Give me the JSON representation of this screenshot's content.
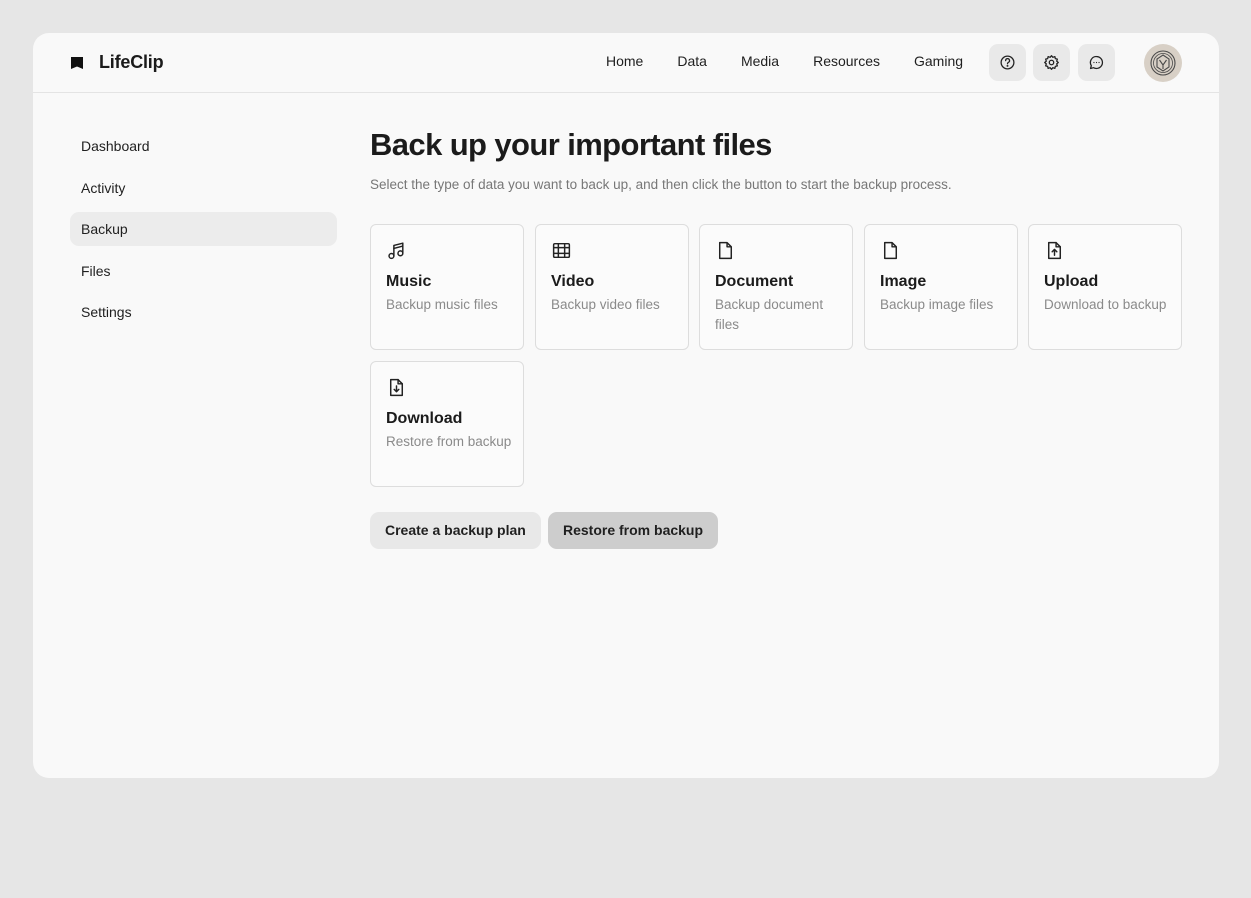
{
  "app": {
    "name": "LifeClip"
  },
  "nav": {
    "links": [
      "Home",
      "Data",
      "Media",
      "Resources",
      "Gaming"
    ]
  },
  "icons": {
    "logo": "flag-icon",
    "help": "help-circle-icon",
    "settings": "gear-icon",
    "chat": "chat-bubble-icon",
    "avatar": "avatar-badge-icon"
  },
  "sidebar": {
    "items": [
      "Dashboard",
      "Activity",
      "Backup",
      "Files",
      "Settings"
    ],
    "active": "Backup"
  },
  "main": {
    "title": "Back up your important files",
    "subtitle": "Select the type of data you want to back up, and then click the button to start the backup process.",
    "cards": [
      {
        "title": "Music",
        "desc": "Backup music files",
        "icon": "music-icon"
      },
      {
        "title": "Video",
        "desc": "Backup video files",
        "icon": "film-icon"
      },
      {
        "title": "Document",
        "desc": "Backup document files",
        "icon": "document-icon"
      },
      {
        "title": "Image",
        "desc": "Backup image files",
        "icon": "file-icon"
      },
      {
        "title": "Upload",
        "desc": "Download to backup",
        "icon": "file-upload-icon"
      },
      {
        "title": "Download",
        "desc": "Restore from backup",
        "icon": "file-download-icon"
      }
    ],
    "buttons": {
      "plan": "Create a backup plan",
      "restore": "Restore from backup"
    }
  },
  "colors": {
    "page_bg": "#e6e6e6",
    "window_bg": "#f9f9f9",
    "active_item_bg": "#ececec",
    "restore_button_bg": "#cdcdcd",
    "muted_text": "#8a8a8a"
  }
}
